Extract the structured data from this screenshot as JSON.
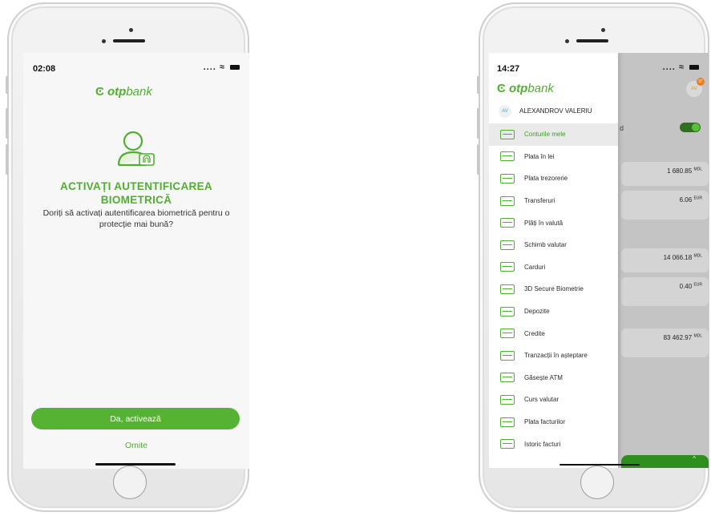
{
  "left_phone": {
    "status_time": "02:08",
    "status_icons": ".... ",
    "logo_otp": "otp",
    "logo_bank": "bank",
    "title_line1": "ACTIVAȚI AUTENTIFICAREA",
    "title_line2": "BIOMETRICĂ",
    "description": "Doriți să activați autentificarea biometrică pentru o protecție mai bună?",
    "primary_button": "Da, activează",
    "skip_link": "Omite"
  },
  "right_phone": {
    "status_time": "14:27",
    "status_icons": ".... ",
    "logo_otp": "otp",
    "logo_bank": "bank",
    "user_initials": "AV",
    "user_name": "ALEXANDROV VALERIU",
    "badge_count": "37",
    "partial_text": "d",
    "balances": [
      {
        "amount": "1 680.85",
        "currency": "MDL"
      },
      {
        "amount": "6.06",
        "currency": "EUR"
      },
      {
        "amount": "14 066.18",
        "currency": "MDL"
      },
      {
        "amount": "0.40",
        "currency": "EUR"
      },
      {
        "amount": "83 462.97",
        "currency": "MDL"
      }
    ],
    "bottom_bar_chevron": "^",
    "menu": [
      {
        "label": "Conturile mele",
        "icon": "bank-building-icon",
        "active": true
      },
      {
        "label": "Plata în lei",
        "icon": "card-icon"
      },
      {
        "label": "Plata trezorerie",
        "icon": "treasury-card-icon"
      },
      {
        "label": "Transferuri",
        "icon": "transfer-arrows-icon"
      },
      {
        "label": "Plăți în valută",
        "icon": "currency-payment-icon"
      },
      {
        "label": "Schimb valutar",
        "icon": "exchange-icon"
      },
      {
        "label": "Carduri",
        "icon": "cards-icon"
      },
      {
        "label": "3D Secure Biometrie",
        "icon": "secure-card-icon"
      },
      {
        "label": "Depozite",
        "icon": "deposit-icon"
      },
      {
        "label": "Credite",
        "icon": "credit-icon"
      },
      {
        "label": "Tranzacții în așteptare",
        "icon": "pending-transactions-icon"
      },
      {
        "label": "Găsește ATM",
        "icon": "location-pin-icon"
      },
      {
        "label": "Curs valutar",
        "icon": "exchange-rate-icon"
      },
      {
        "label": "Plata facturilor",
        "icon": "bill-payment-icon"
      },
      {
        "label": "Istoric facturi",
        "icon": "bill-history-icon"
      }
    ]
  },
  "colors": {
    "brand_green": "#52ae32",
    "button_green": "#56b232",
    "badge_orange": "#e67e22"
  }
}
